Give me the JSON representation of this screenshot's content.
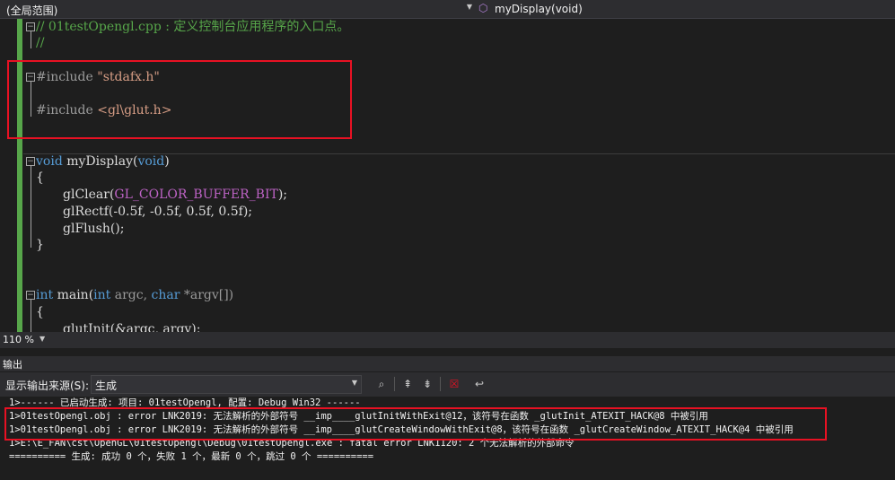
{
  "toolbar": {
    "scope": "(全局范围)",
    "member": "myDisplay(void)"
  },
  "editor": {
    "lines": {
      "l1": "// 01testOpengl.cpp : 定义控制台应用程序的入口点。",
      "l2": "//",
      "inc1_kw": "#include ",
      "inc1_val": "\"stdafx.h\"",
      "inc2_kw": "#include ",
      "inc2_val": "<gl\\glut.h>",
      "fn1_kw": "void",
      "fn1_rest": " myDisplay(",
      "fn1_param": "void",
      "fn1_close": ")",
      "brace_open": "{",
      "s1_a": "glClear(",
      "s1_b": "GL_COLOR_BUFFER_BIT",
      "s1_c": ");",
      "s2": "glRectf(-0.5f, -0.5f, 0.5f, 0.5f);",
      "s3": "glFlush();",
      "brace_close": "}",
      "fn2_kw": "int",
      "fn2_rest": " main(",
      "fn2_kw2": "int",
      "fn2_p1": " argc, ",
      "fn2_kw3": "char",
      "fn2_p2": " *argv[])",
      "brace_open2": "{",
      "s4": "glutInit(&argc, argv);"
    }
  },
  "zoom": "110 %",
  "output": {
    "title": "输出",
    "source_label": "显示输出来源(S):",
    "source_value": "生成",
    "lines": [
      "1>------ 已启动生成: 项目: 01testOpengl, 配置: Debug Win32 ------",
      "1>01testOpengl.obj : error LNK2019: 无法解析的外部符号 __imp____glutInitWithExit@12，该符号在函数 _glutInit_ATEXIT_HACK@8 中被引用",
      "1>01testOpengl.obj : error LNK2019: 无法解析的外部符号 __imp____glutCreateWindowWithExit@8，该符号在函数 _glutCreateWindow_ATEXIT_HACK@4 中被引用",
      "1>E:\\E_FAN\\cst\\OpenGL\\01testOpengl\\Debug\\01testOpengl.exe : fatal error LNK1120: 2 个无法解析的外部命令",
      "========== 生成: 成功 0 个，失败 1 个，最新 0 个，跳过 0 个 =========="
    ]
  }
}
